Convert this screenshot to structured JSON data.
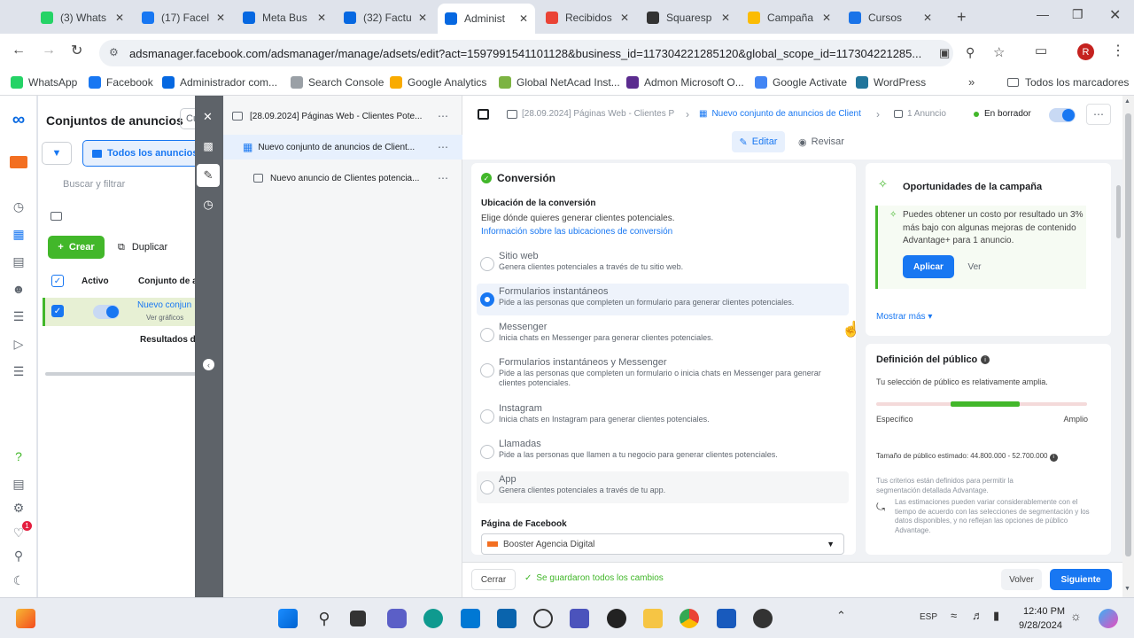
{
  "browser": {
    "tabs": [
      {
        "title": "(3) Whats",
        "icon": "whatsapp-icon",
        "color": "#25d366"
      },
      {
        "title": "(17) Facel",
        "icon": "facebook-icon",
        "color": "#1877f2"
      },
      {
        "title": "Meta Bus",
        "icon": "meta-icon",
        "color": "#0668e1"
      },
      {
        "title": "(32) Factu",
        "icon": "meta-icon",
        "color": "#0668e1"
      },
      {
        "title": "Administ",
        "icon": "meta-icon",
        "color": "#0668e1"
      },
      {
        "title": "Recibidos",
        "icon": "gmail-icon",
        "color": "#ea4335"
      },
      {
        "title": "Squaresp",
        "icon": "squarespace-icon",
        "color": "#333333"
      },
      {
        "title": "Campaña",
        "icon": "google-ads-icon",
        "color": "#fbbc04"
      },
      {
        "title": "Cursos",
        "icon": "dollar-icon",
        "color": "#1a73e8"
      }
    ],
    "url": "adsmanager.facebook.com/adsmanager/manage/adsets/edit?act=1597991541101128&business_id=117304221285120&global_scope_id=117304221285...",
    "bookmarks": [
      "WhatsApp",
      "Facebook",
      "Administrador com...",
      "Search Console",
      "Google Analytics",
      "Global NetAcad Inst...",
      "Admon Microsoft O...",
      "Google Activate",
      "WordPress"
    ],
    "all_bookmarks": "Todos los marcadores",
    "profile_initial": "R"
  },
  "list": {
    "title": "Conjuntos de anuncios",
    "tab_cut": "Cu",
    "filter_chip": "Todos los anuncios",
    "search_placeholder": "Buscar y filtrar",
    "create_label": "Crear",
    "duplicate_label": "Duplicar",
    "col_active": "Activo",
    "col_name": "Conjunto de a",
    "row_name": "Nuevo conjun",
    "row_sub": "Ver gráficos",
    "results": "Resultados d"
  },
  "tree": {
    "campaign": "[28.09.2024] Páginas Web - Clientes Pote...",
    "adset": "Nuevo conjunto de anuncios de Client...",
    "ad": "Nuevo anuncio de Clientes potencia..."
  },
  "breadcrumb": {
    "campaign": "[28.09.2024] Páginas Web - Clientes P",
    "adset": "Nuevo conjunto de anuncios de Client",
    "ad": "1 Anuncio",
    "status": "En borrador"
  },
  "modes": {
    "edit": "Editar",
    "review": "Revisar"
  },
  "conversion": {
    "heading": "Conversión",
    "location_label": "Ubicación de la conversión",
    "location_help": "Elige dónde quieres generar clientes potenciales.",
    "info_link": "Información sobre las ubicaciones de conversión",
    "options": [
      {
        "title": "Sitio web",
        "desc": "Genera clientes potenciales a través de tu sitio web.",
        "selected": false
      },
      {
        "title": "Formularios instantáneos",
        "desc": "Pide a las personas que completen un formulario para generar clientes potenciales.",
        "selected": true
      },
      {
        "title": "Messenger",
        "desc": "Inicia chats en Messenger para generar clientes potenciales.",
        "selected": false
      },
      {
        "title": "Formularios instantáneos y Messenger",
        "desc": "Pide a las personas que completen un formulario o inicia chats en Messenger para generar clientes potenciales.",
        "selected": false
      },
      {
        "title": "Instagram",
        "desc": "Inicia chats en Instagram para generar clientes potenciales.",
        "selected": false
      },
      {
        "title": "Llamadas",
        "desc": "Pide a las personas que llamen a tu negocio para generar clientes potenciales.",
        "selected": false
      },
      {
        "title": "App",
        "desc": "Genera clientes potenciales a través de tu app.",
        "selected": false
      }
    ],
    "page_label": "Página de Facebook",
    "page_value": "Booster Agencia Digital"
  },
  "opportunities": {
    "title": "Oportunidades de la campaña",
    "text": "Puedes obtener un costo por resultado un 3% más bajo con algunas mejoras de contenido Advantage+ para 1 anuncio.",
    "apply": "Aplicar",
    "view": "Ver",
    "more": "Mostrar más"
  },
  "audience": {
    "title": "Definición del público",
    "note": "Tu selección de público es relativamente amplia.",
    "specific": "Específico",
    "broad": "Amplio",
    "level": 0.68,
    "size": "Tamaño de público estimado: 44.800.000 - 52.700.000",
    "criteria": "Tus criterios están definidos para permitir la segmentación detallada Advantage.",
    "estimates": "Las estimaciones pueden variar considerablemente con el tiempo de acuerdo con las selecciones de segmentación y los datos disponibles, y no reflejan las opciones de público Advantage."
  },
  "footer": {
    "close": "Cerrar",
    "saved": "Se guardaron todos los cambios",
    "back": "Volver",
    "next": "Siguiente"
  },
  "taskbar": {
    "lang": "ESP",
    "time": "12:40 PM",
    "date": "9/28/2024"
  },
  "colors": {
    "accent": "#1877f2",
    "green": "#42b72a",
    "dark_rail": "#5e6369"
  }
}
